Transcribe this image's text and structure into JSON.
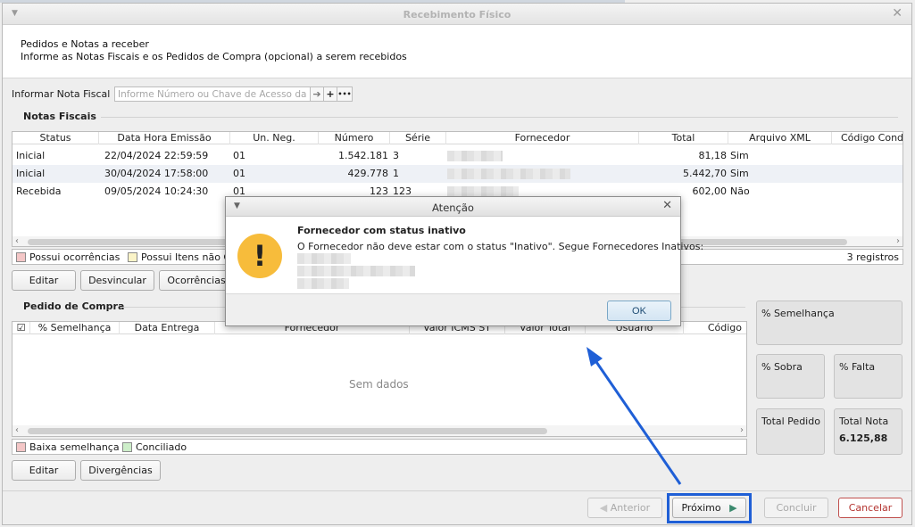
{
  "window": {
    "title": "Recebimento Físico"
  },
  "header": {
    "title": "Pedidos e Notas a receber",
    "subtitle": "Informe as Notas Fiscais e os Pedidos de Compra (opcional) a serem recebidos"
  },
  "nf_input": {
    "label": "Informar Nota Fiscal",
    "placeholder": "Informe Número ou Chave de Acesso da NF",
    "arrow_btn": "➔",
    "add_btn": "+",
    "more_btn": "•••"
  },
  "notas": {
    "section_title": "Notas Fiscais",
    "columns": [
      "Status",
      "Data Hora Emissão",
      "Un. Neg.",
      "Número",
      "Série",
      "Fornecedor",
      "Total",
      "Arquivo XML",
      "Código Cond"
    ],
    "rows": [
      {
        "status": "Inicial",
        "data": "22/04/2024 22:59:59",
        "un": "01",
        "numero": "1.542.181",
        "serie": "3",
        "total": "81,18",
        "xml": "Sim"
      },
      {
        "status": "Inicial",
        "data": "30/04/2024 17:58:00",
        "un": "01",
        "numero": "429.778",
        "serie": "1",
        "total": "5.442,70",
        "xml": "Sim"
      },
      {
        "status": "Recebida",
        "data": "09/05/2024 10:24:30",
        "un": "01",
        "numero": "123",
        "serie": "123",
        "total": "602,00",
        "xml": "Não"
      }
    ],
    "legend": [
      "Possui ocorrências",
      "Possui Itens não C"
    ],
    "count": "3 registros",
    "buttons": {
      "editar": "Editar",
      "desvincular": "Desvincular",
      "ocorrencias": "Ocorrências"
    }
  },
  "pedido": {
    "section_title": "Pedido de Compra",
    "columns": [
      "% Semelhança",
      "Data Entrega",
      "Fornecedor",
      "Valor ICMS ST",
      "Valor Total",
      "Usuário",
      "Código"
    ],
    "empty": "Sem dados",
    "legend": [
      "Baixa semelhança",
      "Conciliado"
    ],
    "buttons": {
      "editar": "Editar",
      "divergencias": "Divergências"
    }
  },
  "stats": {
    "semelhanca": "% Semelhança",
    "sobra": "% Sobra",
    "falta": "% Falta",
    "total_pedido": "Total Pedido",
    "total_nota": "Total Nota",
    "total_nota_value": "6.125,88"
  },
  "footer": {
    "anterior": "Anterior",
    "proximo": "Próximo",
    "concluir": "Concluir",
    "cancelar": "Cancelar"
  },
  "dialog": {
    "title": "Atenção",
    "heading": "Fornecedor com status inativo",
    "message": "O Fornecedor não deve estar com o status \"Inativo\". Segue Fornecedores Inativos:",
    "ok": "OK"
  },
  "colors": {
    "accent": "#1f5fd6",
    "warning": "#f7bc3b",
    "cancel": "#c0504d"
  }
}
